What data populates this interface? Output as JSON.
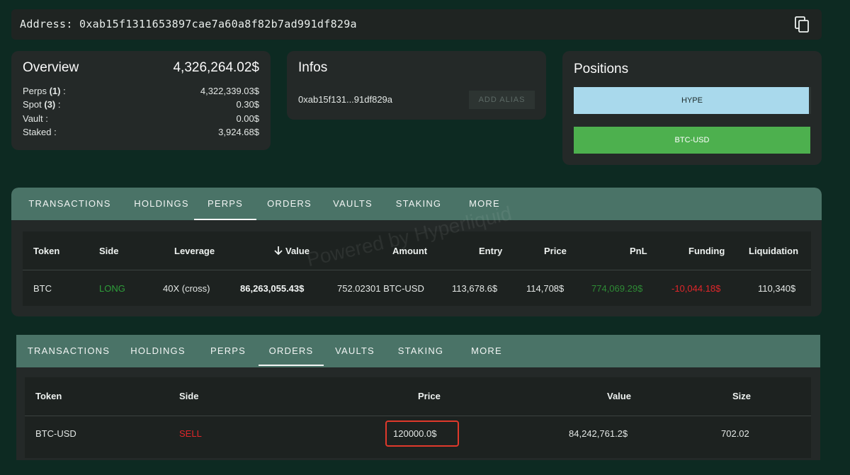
{
  "address_bar": {
    "label": "Address:",
    "address": "0xab15f1311653897cae7a60a8f82b7ad991df829a",
    "copy_icon": "copy-icon"
  },
  "overview": {
    "title": "Overview",
    "total": "4,326,264.02$",
    "rows": [
      {
        "label": "Perps",
        "count": "(1)",
        "suffix": " :",
        "value": "4,322,339.03$"
      },
      {
        "label": "Spot",
        "count": "(3)",
        "suffix": " :",
        "value": "0.30$"
      },
      {
        "label": "Vault",
        "count": "",
        "suffix": " :",
        "value": "0.00$"
      },
      {
        "label": "Staked",
        "count": "",
        "suffix": " :",
        "value": "3,924.68$"
      }
    ]
  },
  "infos": {
    "title": "Infos",
    "short_address": "0xab15f131...91df829a",
    "add_alias_label": "ADD ALIAS"
  },
  "positions": {
    "title": "Positions",
    "items": [
      {
        "label": "HYPE",
        "color": "#a9d9ec"
      },
      {
        "label": "BTC-USD",
        "color": "#4db04e"
      }
    ]
  },
  "tabs": [
    "TRANSACTIONS",
    "HOLDINGS",
    "PERPS",
    "ORDERS",
    "VAULTS",
    "STAKING",
    "MORE"
  ],
  "perps_panel": {
    "active_tab": "PERPS",
    "sort_icon": "arrow-down-icon",
    "headers": [
      "Token",
      "Side",
      "Leverage",
      "Value",
      "Amount",
      "Entry",
      "Price",
      "PnL",
      "Funding",
      "Liquidation"
    ],
    "rows": [
      {
        "token": "BTC",
        "side": "LONG",
        "leverage": "40X (cross)",
        "value": "86,263,055.43$",
        "amount": "752.02301 BTC-USD",
        "entry": "113,678.6$",
        "price": "114,708$",
        "pnl": "774,069.29$",
        "funding": "-10,044.18$",
        "liquidation": "110,340$"
      }
    ],
    "colors": {
      "long": "#2e9e3a",
      "pnl_positive": "#2e8b35",
      "funding_negative": "#e0262a"
    }
  },
  "watermark": "Powered by Hyperliquid",
  "orders_panel": {
    "active_tab": "ORDERS",
    "headers": [
      "Token",
      "Side",
      "Price",
      "Value",
      "Size"
    ],
    "rows": [
      {
        "token": "BTC-USD",
        "side": "SELL",
        "price": "120000.0$",
        "value": "84,242,761.2$",
        "size": "702.02"
      }
    ],
    "colors": {
      "sell": "#e0262a",
      "highlight": "#e0392b"
    }
  }
}
